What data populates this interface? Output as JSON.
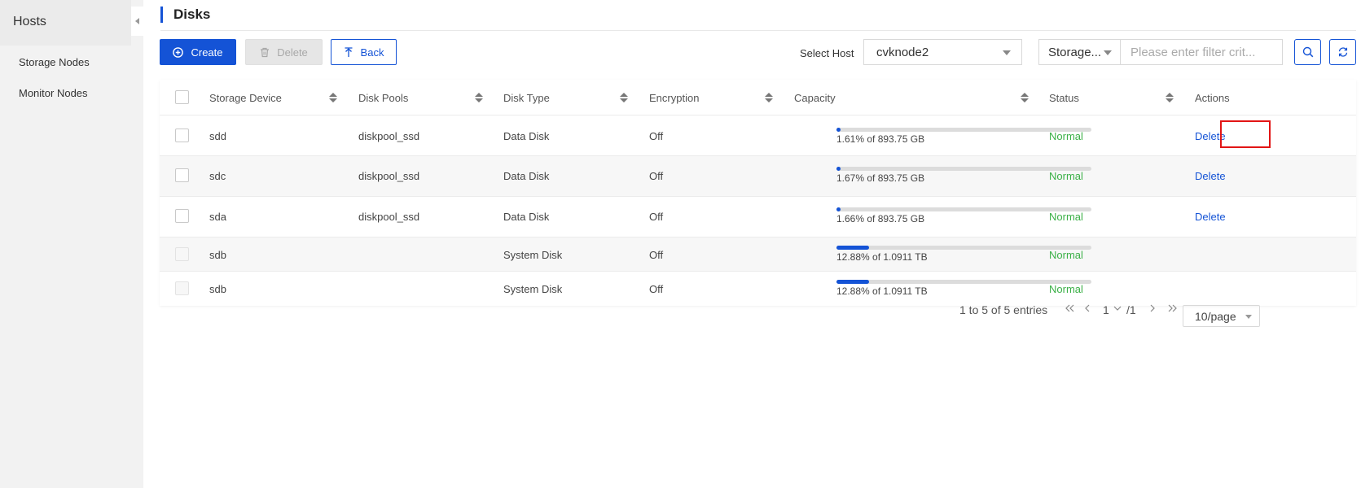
{
  "sidebar": {
    "title": "Hosts",
    "items": [
      {
        "label": "Storage Nodes"
      },
      {
        "label": "Monitor Nodes"
      }
    ]
  },
  "page": {
    "title": "Disks"
  },
  "toolbar": {
    "create_label": "Create",
    "delete_label": "Delete",
    "back_label": "Back",
    "host_label": "Select Host",
    "host_value": "cvknode2",
    "filter_type": "Storage...",
    "filter_placeholder": "Please enter filter crit..."
  },
  "table": {
    "columns": [
      "Storage Device",
      "Disk Pools",
      "Disk Type",
      "Encryption",
      "Capacity",
      "Status",
      "Actions"
    ],
    "rows": [
      {
        "device": "sdd",
        "pool": "diskpool_ssd",
        "type": "Data Disk",
        "encryption": "Off",
        "usage": 1.61,
        "capacity": "1.61%  of  893.75  GB",
        "status": "Normal",
        "action": "Delete"
      },
      {
        "device": "sdc",
        "pool": "diskpool_ssd",
        "type": "Data Disk",
        "encryption": "Off",
        "usage": 1.67,
        "capacity": "1.67%  of  893.75  GB",
        "status": "Normal",
        "action": "Delete"
      },
      {
        "device": "sda",
        "pool": "diskpool_ssd",
        "type": "Data Disk",
        "encryption": "Off",
        "usage": 1.66,
        "capacity": "1.66%  of  893.75  GB",
        "status": "Normal",
        "action": "Delete"
      },
      {
        "device": "sdb",
        "pool": "",
        "type": "System Disk",
        "encryption": "Off",
        "usage": 12.88,
        "capacity": "12.88%  of  1.0911  TB",
        "status": "Normal",
        "action": ""
      },
      {
        "device": "sdb",
        "pool": "",
        "type": "System Disk",
        "encryption": "Off",
        "usage": 12.88,
        "capacity": "12.88%  of  1.0911  TB",
        "status": "Normal",
        "action": ""
      }
    ]
  },
  "pagination": {
    "summary": "1  to  5  of  5  entries",
    "current": "1",
    "total": "/1",
    "page_size": "10/page"
  },
  "colors": {
    "accent": "#1453d6",
    "status_normal": "#3bb047",
    "highlight": "#e21515"
  }
}
